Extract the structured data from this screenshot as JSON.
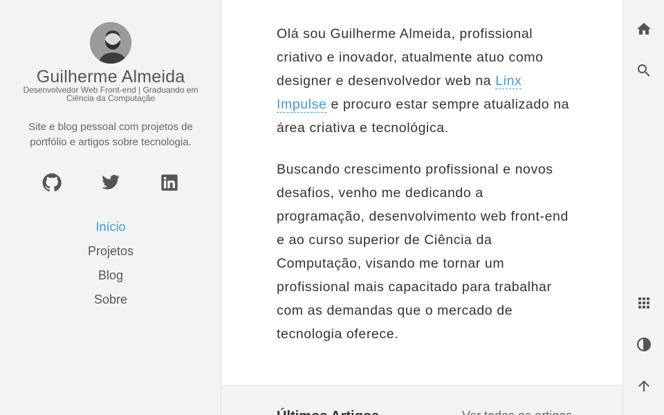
{
  "profile": {
    "name": "Guilherme Almeida",
    "role": "Desenvolvedor Web Front-end | Graduando em Ciência da Computação",
    "description": "Site e blog pessoal com projetos de portfólio e artigos sobre tecnologia."
  },
  "social": [
    {
      "name": "github-icon"
    },
    {
      "name": "twitter-icon"
    },
    {
      "name": "linkedin-icon"
    }
  ],
  "nav": {
    "items": [
      {
        "label": "Início",
        "active": true
      },
      {
        "label": "Projetos",
        "active": false
      },
      {
        "label": "Blog",
        "active": false
      },
      {
        "label": "Sobre",
        "active": false
      }
    ]
  },
  "content": {
    "p1_before": "Olá sou Guilherme Almeida, profissional criativo e inovador, atualmente atuo como designer e desenvolvedor web na ",
    "p1_link": "Linx Impulse",
    "p1_after": " e procuro estar sempre atualizado na área criativa e tecnológica.",
    "p2": "Buscando crescimento profissional e novos desafios, venho me dedicando a programação, desenvolvimento web front-end e ao curso superior de Ciência da Computação, visando me tornar um profissional mais capacitado para trabalhar com as demandas que o mercado de tecnologia oferece.",
    "footer_left": "Últimos Artigos",
    "footer_right": "Ver todos os artigos"
  },
  "actions": [
    "home-icon",
    "search-icon",
    "grid-icon",
    "contrast-icon",
    "arrow-up-icon"
  ],
  "colors": {
    "accent": "#3a9fd6",
    "sidebar_bg": "#f3f3f5",
    "text": "#333333",
    "icon": "#555555"
  }
}
